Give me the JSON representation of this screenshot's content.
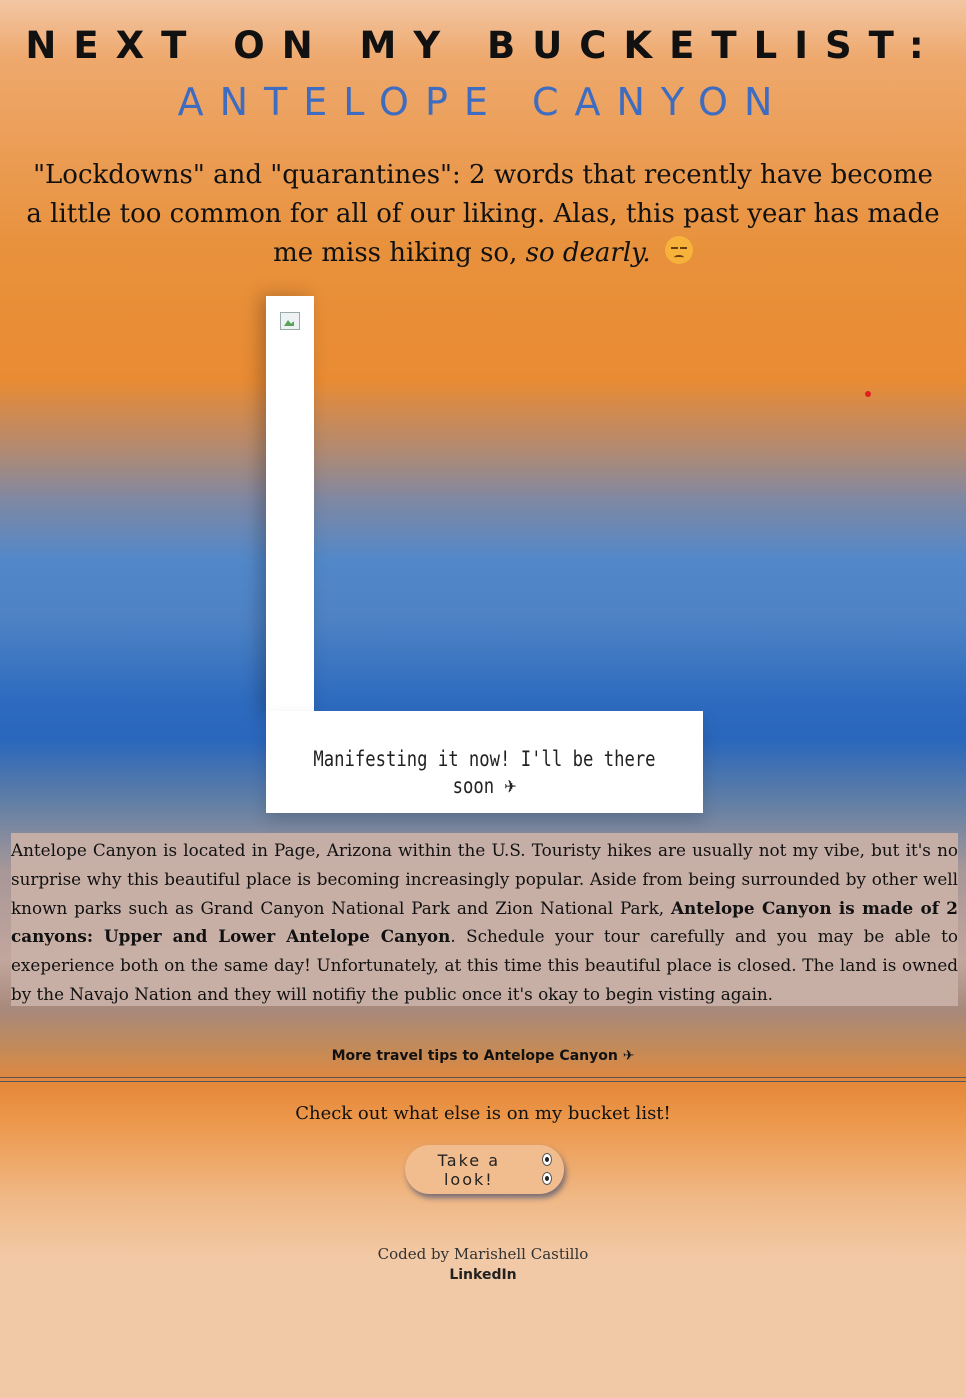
{
  "header": {
    "title_line1": "NEXT ON MY BUCKETLIST:",
    "title_line2": "ANTELOPE CANYON"
  },
  "intro": {
    "text_main": "\"Lockdowns\" and \"quarantines\": 2 words that recently have become a little too common for all of our liking. Alas, this past year has made me miss hiking so,",
    "text_italic": "so dearly.",
    "emoji_icon": "pensive-face-icon"
  },
  "photo": {
    "caption": "Manifesting it now! I'll be there soon",
    "caption_icon": "airplane-icon"
  },
  "info": {
    "part1": "Antelope Canyon is located in Page, Arizona within the U.S. Touristy hikes are usually not my vibe, but it's no surprise why this beautiful place is becoming increasingly popular. Aside from being surrounded by other well known parks such as Grand Canyon National Park and Zion National Park,",
    "bold": "Antelope Canyon is made of 2 canyons: Upper and Lower Antelope Canyon",
    "part2": ". Schedule your tour carefully and you may be able to exeperience both on the same day! Unfortunately, at this time this beautiful place is closed. The land is owned by the Navajo Nation and they will notifiy the public once it's okay to begin visting again."
  },
  "links": {
    "tips_label": "More travel tips to Antelope Canyon",
    "tips_icon": "airplane-icon"
  },
  "bucket": {
    "prompt": "Check out what else is on my bucket list!",
    "button_label": "Take a look!",
    "button_icon": "eyes-icon"
  },
  "footer": {
    "credit": "Coded by Marishell Castillo",
    "linkedin": "LinkedIn"
  },
  "colors": {
    "title_dark": "#111111",
    "title_blue": "#3d6cc0",
    "accent_orange": "#e8913c",
    "accent_blue": "#2a67bc",
    "info_bg": "#c8b0a6",
    "button_bg": "#f2bd8e"
  }
}
